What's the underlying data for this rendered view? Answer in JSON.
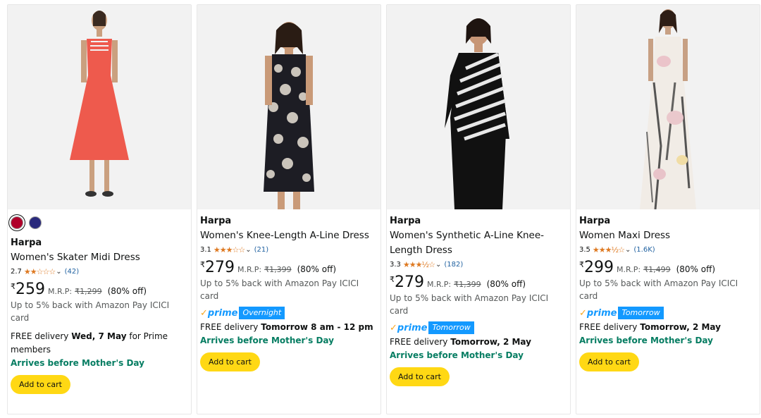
{
  "products": [
    {
      "colors": [
        "#b0002a",
        "#2a2a7c"
      ],
      "brand": "Harpa",
      "title_lines": [
        "Women's Skater Midi Dress"
      ],
      "rating": "2.7",
      "stars": "★★☆☆☆",
      "review_count": "(42)",
      "currency": "₹",
      "price": "259",
      "mrp_label": "M.R.P:",
      "mrp": "₹1,299",
      "discount": "(80% off)",
      "cashback": "Up to 5% back with Amazon Pay ICICI card",
      "prime_badge": "",
      "delivery_prefix": "FREE delivery",
      "delivery_date": "Wed, 7 May",
      "delivery_suffix": "for Prime members",
      "mothers_day": "Arrives before Mother's Day",
      "add_to_cart": "Add to cart"
    },
    {
      "colors": [],
      "brand": "Harpa",
      "title_lines": [
        "Women's Knee-Length A-Line Dress"
      ],
      "rating": "3.1",
      "stars": "★★★☆☆",
      "review_count": "(21)",
      "currency": "₹",
      "price": "279",
      "mrp_label": "M.R.P:",
      "mrp": "₹1,399",
      "discount": "(80% off)",
      "cashback": "Up to 5% back with Amazon Pay ICICI card",
      "prime_word": "prime",
      "prime_badge": "Overnight",
      "delivery_prefix": "FREE delivery",
      "delivery_date": "Tomorrow 8 am - 12 pm",
      "delivery_suffix": "",
      "mothers_day": "Arrives before Mother's Day",
      "add_to_cart": "Add to cart"
    },
    {
      "colors": [],
      "brand": "Harpa",
      "title_lines": [
        "Women's Synthetic A-Line Knee-",
        "Length Dress"
      ],
      "rating": "3.3",
      "stars": "★★★½☆",
      "review_count": "(182)",
      "currency": "₹",
      "price": "279",
      "mrp_label": "M.R.P:",
      "mrp": "₹1,399",
      "discount": "(80% off)",
      "cashback": "Up to 5% back with Amazon Pay ICICI card",
      "prime_word": "prime",
      "prime_badge": "Tomorrow",
      "delivery_prefix": "FREE delivery",
      "delivery_date": "Tomorrow, 2 May",
      "delivery_suffix": "",
      "mothers_day": "Arrives before Mother's Day",
      "add_to_cart": "Add to cart"
    },
    {
      "colors": [],
      "brand": "Harpa",
      "title_lines": [
        "Women Maxi Dress"
      ],
      "rating": "3.5",
      "stars": "★★★½☆",
      "review_count": "(1.6K)",
      "currency": "₹",
      "price": "299",
      "mrp_label": "M.R.P:",
      "mrp": "₹1,499",
      "discount": "(80% off)",
      "cashback": "Up to 5% back with Amazon Pay ICICI card",
      "prime_word": "prime",
      "prime_badge": "Tomorrow",
      "delivery_prefix": "FREE delivery",
      "delivery_date": "Tomorrow, 2 May",
      "delivery_suffix": "",
      "mothers_day": "Arrives before Mother's Day",
      "add_to_cart": "Add to cart"
    }
  ]
}
